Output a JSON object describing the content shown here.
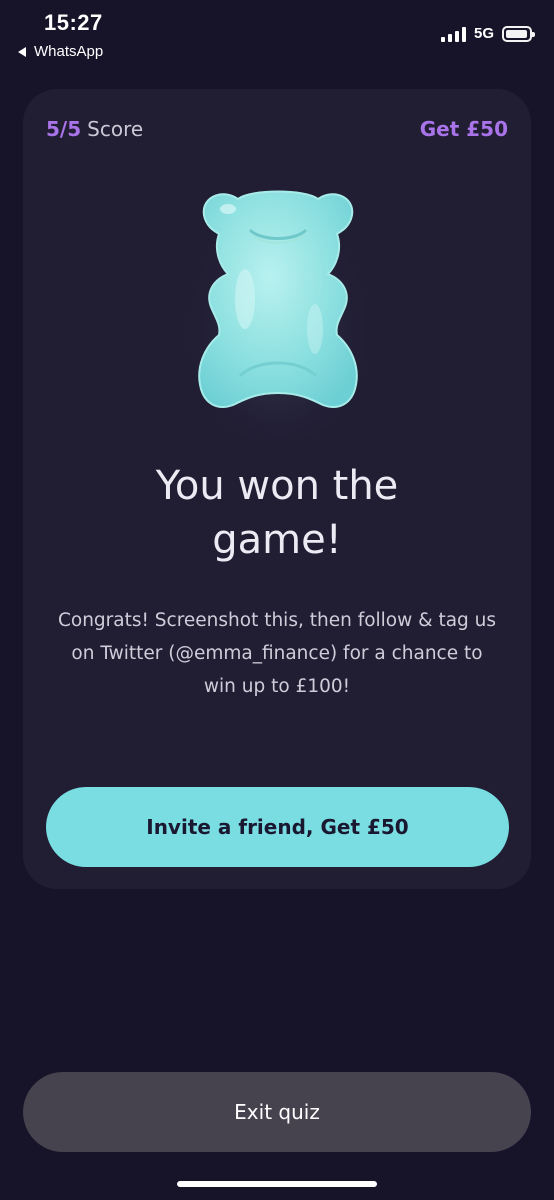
{
  "status_bar": {
    "time": "15:27",
    "back_app": "WhatsApp",
    "network": "5G"
  },
  "card": {
    "score_value": "5/5",
    "score_label": "Score",
    "reward_link": "Get £50",
    "title": "You won the game!",
    "body": "Congrats! Screenshot this, then follow & tag us on Twitter (@emma_finance) for a chance to win up to  £100!",
    "invite_button": "Invite a friend, Get £50"
  },
  "footer": {
    "exit_button": "Exit quiz"
  },
  "colors": {
    "background": "#17142a",
    "card": "#211d33",
    "accent_purple": "#a974e9",
    "accent_teal": "#79dde2",
    "exit_button": "#46434f"
  },
  "icons": {
    "signal": "signal-bars-icon",
    "battery": "battery-icon",
    "back": "back-arrow-icon",
    "mascot": "gummy-bear-icon"
  }
}
